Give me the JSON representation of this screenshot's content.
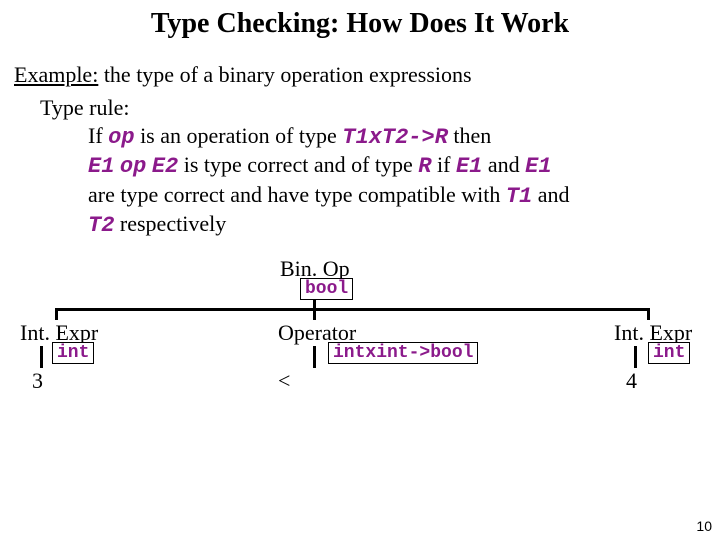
{
  "title": "Type Checking: How Does It Work",
  "example": {
    "prefix": "Example:",
    "text": " the type of a binary operation expressions"
  },
  "rule": {
    "heading": "Type rule:",
    "line1a": "If ",
    "op": "op",
    "line1b": " is an operation of type ",
    "sig": "T1xT2->R",
    "line1c": " then",
    "line2a": "",
    "e1": "E1",
    "line2b": " ",
    "line2c": " ",
    "e2": "E2",
    "line2d": " is type correct and of type ",
    "r": "R",
    "line2e": " if ",
    "line2f": " and ",
    "line3a": "are type correct and have  type compatible with ",
    "t1": "T1",
    "line3b": " and",
    "t2": "T2",
    "line4b": " respectively"
  },
  "tree": {
    "root": {
      "label": "Bin. Op",
      "type": "bool"
    },
    "left": {
      "label": "Int. Expr",
      "type": "int",
      "leaf": "3"
    },
    "mid": {
      "label": "Operator",
      "type": "intxint->bool",
      "leaf": "<"
    },
    "right": {
      "label": "Int. Expr",
      "type": "int",
      "leaf": "4"
    }
  },
  "page": "10"
}
